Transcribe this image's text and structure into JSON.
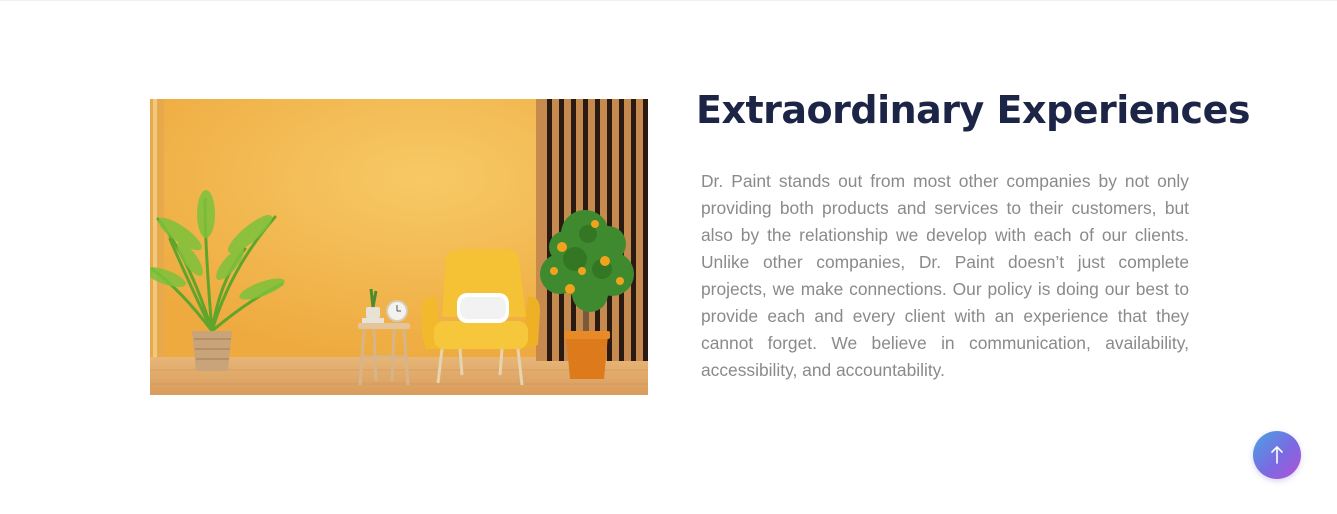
{
  "section": {
    "heading": "Extraordinary Experiences",
    "paragraph": "Dr. Paint stands out from most other companies by not only providing both products and services to their customers, but also by the relationship we develop with each of our clients. Unlike other companies, Dr. Paint doesn’t just complete projects, we make connections. Our policy is doing our best to provide each and every client with an experience that they cannot forget. We believe in communication, availability, accessibility, and accountability."
  },
  "image": {
    "subject": "yellow armchair with white pillow in orange room with potted plants"
  },
  "scroll_top": {
    "icon": "arrow-up-icon"
  },
  "colors": {
    "heading": "#1d2546",
    "body_text": "#8a8a8a",
    "wall": "#f2b94f",
    "button_gradient_start": "#4aa3e3",
    "button_gradient_end": "#b152d6"
  }
}
